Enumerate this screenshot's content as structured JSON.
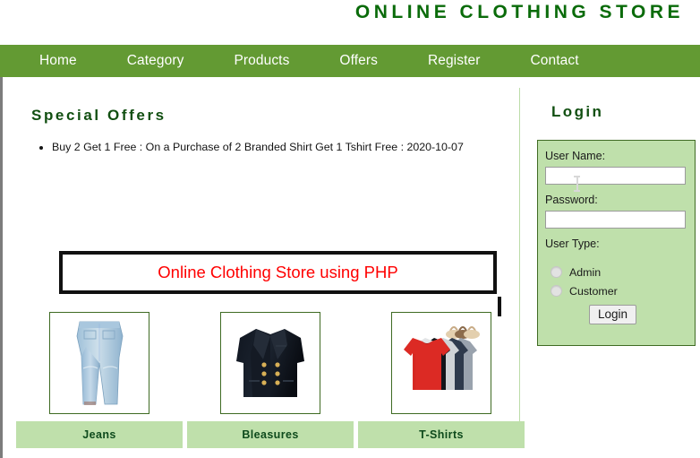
{
  "header": {
    "site_title": "ONLINE CLOTHING STORE"
  },
  "nav": {
    "items": [
      {
        "label": "Home"
      },
      {
        "label": "Category"
      },
      {
        "label": "Products"
      },
      {
        "label": "Offers"
      },
      {
        "label": "Register"
      },
      {
        "label": "Contact"
      }
    ]
  },
  "main": {
    "section_title": "Special Offers",
    "offers": [
      "Buy 2 Get 1 Free : On a Purchase of 2 Branded Shirt Get 1 Tshirt Free : 2020-10-07"
    ],
    "banner": {
      "text": "Online Clothing Store using PHP",
      "text_color": "#ff0000",
      "border_color": "#111111"
    },
    "products": [
      {
        "label": "Jeans",
        "image": "jeans-image"
      },
      {
        "label": "Bleasures",
        "image": "blazer-image"
      },
      {
        "label": "T-Shirts",
        "image": "tshirts-image"
      }
    ]
  },
  "login": {
    "title": "Login",
    "username_label": "User Name:",
    "username_value": "",
    "password_label": "Password:",
    "password_value": "",
    "usertype_label": "User Type:",
    "usertype_options": [
      {
        "label": "Admin",
        "selected": false
      },
      {
        "label": "Customer",
        "selected": false
      }
    ],
    "submit_label": "Login"
  },
  "theme": {
    "nav_green": "#639a33",
    "title_green": "#0a6b0a",
    "panel_green": "#bfe0ab",
    "border_green": "#3f6b23",
    "heading_green": "#114f11"
  }
}
